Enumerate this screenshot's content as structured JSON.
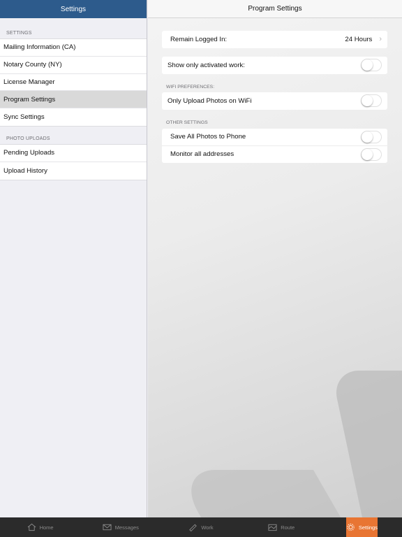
{
  "left": {
    "title": "Settings",
    "sections": [
      {
        "label": "SETTINGS",
        "items": [
          "Mailing Information (CA)",
          "Notary County (NY)",
          "License Manager",
          "Program Settings",
          "Sync Settings"
        ]
      },
      {
        "label": "PHOTO UPLOADS",
        "items": [
          "Pending Uploads",
          "Upload History"
        ]
      }
    ]
  },
  "right": {
    "title": "Program Settings",
    "remain_logged_in": {
      "label": "Remain Logged In:",
      "value": "24 Hours"
    },
    "show_activated": {
      "label": "Show only activated work:",
      "on": false
    },
    "wifi_label": "WIFI PREFERENCES:",
    "upload_wifi": {
      "label": "Only Upload Photos on WiFi",
      "on": false
    },
    "other_label": "OTHER SETTINGS",
    "save_photos": {
      "label": "Save All Photos to Phone",
      "on": false
    },
    "monitor": {
      "label": "Monitor all addresses",
      "on": false
    }
  },
  "tabs": {
    "home": "Home",
    "messages": "Messages",
    "work": "Work",
    "route": "Route",
    "settings": "Settings"
  },
  "colors": {
    "header_blue": "#2d5b8c",
    "active_tab": "#e87533"
  }
}
